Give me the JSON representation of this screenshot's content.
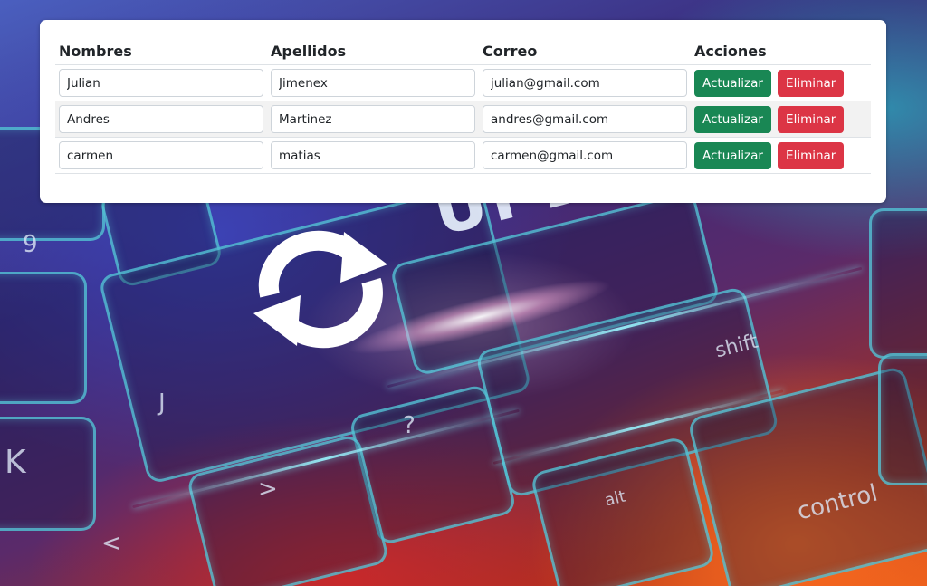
{
  "colors": {
    "success": "#198754",
    "danger": "#dc3545"
  },
  "background": {
    "image_text": "UPDA",
    "refresh_icon": "refresh-icon",
    "key_labels": [
      "9",
      "K",
      "?",
      "shift",
      "alt",
      "control",
      "<",
      ">",
      "J"
    ]
  },
  "table": {
    "headers": {
      "nombres": "Nombres",
      "apellidos": "Apellidos",
      "correo": "Correo",
      "acciones": "Acciones"
    },
    "rows": [
      {
        "nombre": "Julian",
        "apellido": "Jimenex",
        "correo": "julian@gmail.com",
        "update_label": "Actualizar",
        "delete_label": "Eliminar"
      },
      {
        "nombre": "Andres",
        "apellido": "Martinez",
        "correo": "andres@gmail.com",
        "update_label": "Actualizar",
        "delete_label": "Eliminar"
      },
      {
        "nombre": "carmen",
        "apellido": "matias",
        "correo": "carmen@gmail.com",
        "update_label": "Actualizar",
        "delete_label": "Eliminar"
      }
    ]
  }
}
